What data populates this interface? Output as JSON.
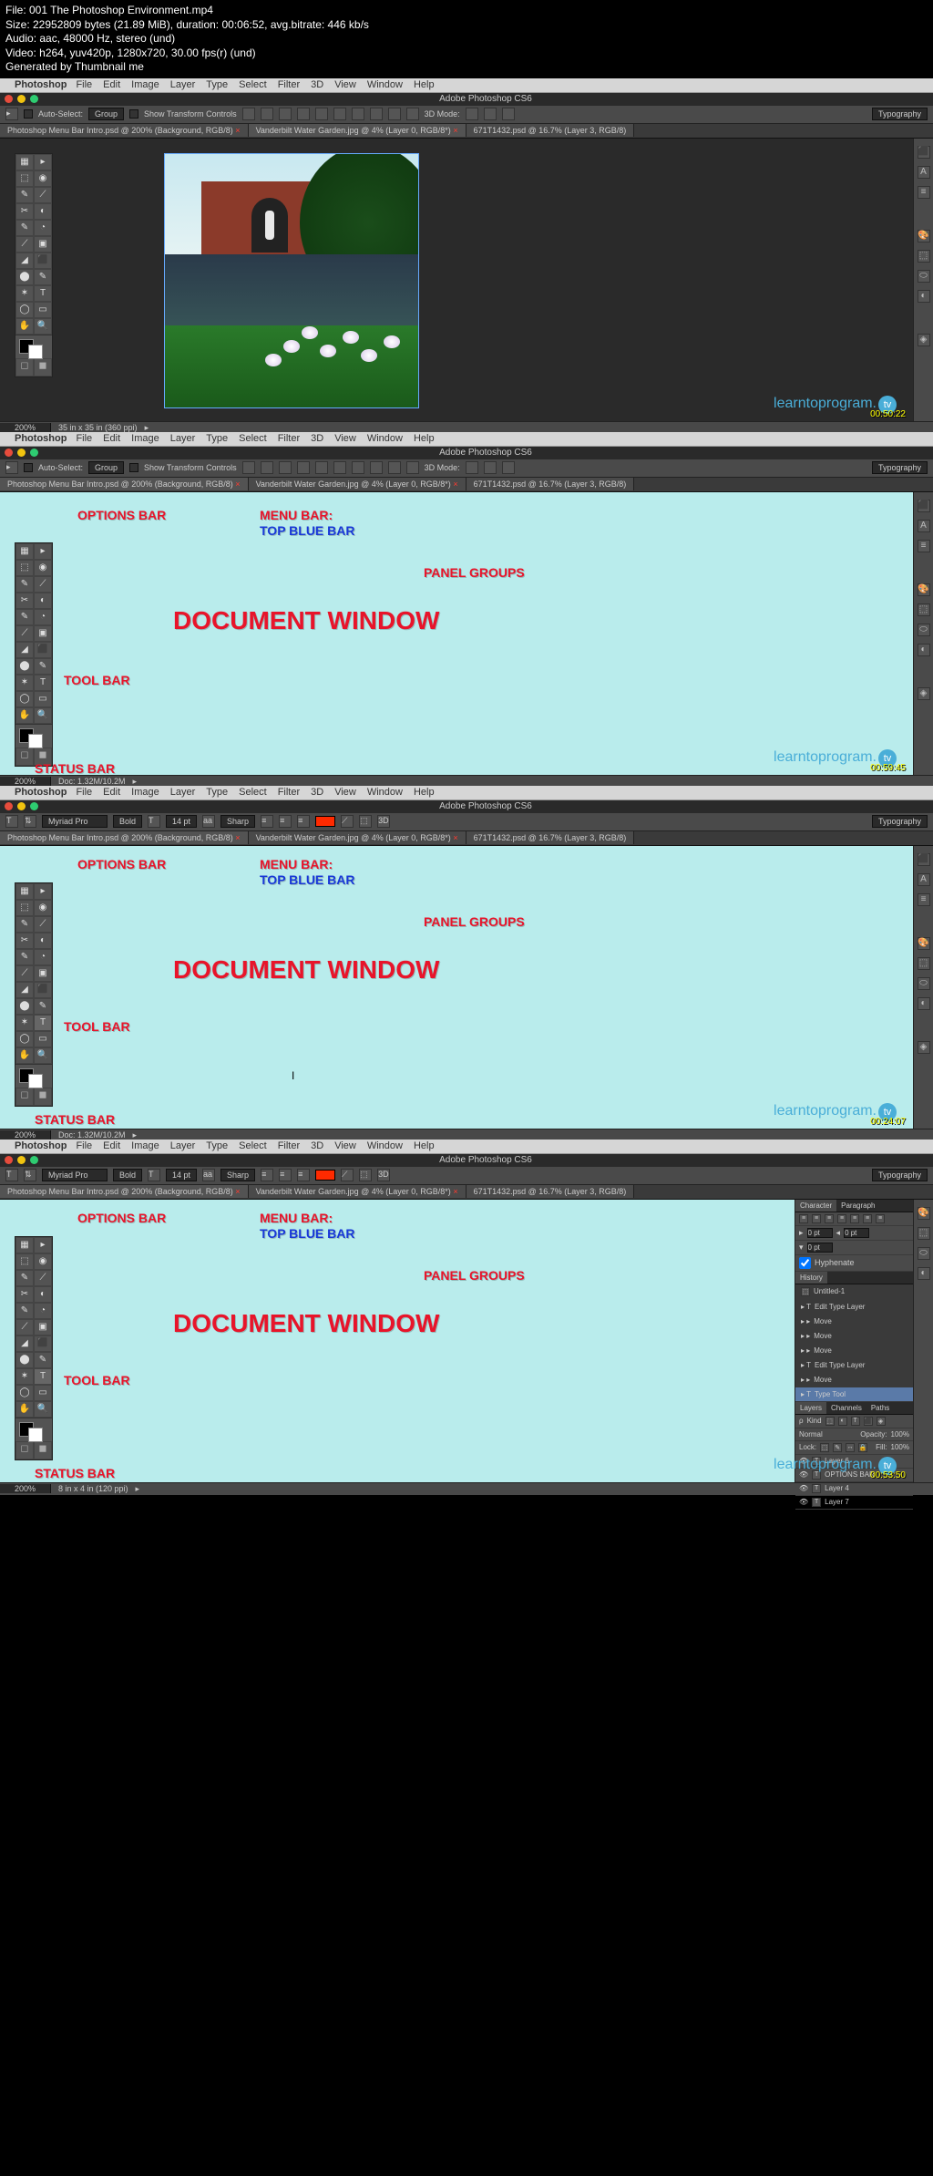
{
  "meta": {
    "file": "File: 001 The Photoshop Environment.mp4",
    "size": "Size: 22952809 bytes (21.89 MiB), duration: 00:06:52, avg.bitrate: 446 kb/s",
    "audio": "Audio: aac, 48000 Hz, stereo (und)",
    "video": "Video: h264, yuv420p, 1280x720, 30.00 fps(r) (und)",
    "gen": "Generated by Thumbnail me"
  },
  "mac": {
    "app": "Photoshop",
    "items": [
      "File",
      "Edit",
      "Image",
      "Layer",
      "Type",
      "Select",
      "Filter",
      "3D",
      "View",
      "Window",
      "Help"
    ]
  },
  "title": "Adobe Photoshop CS6",
  "opt1": {
    "auto": "Auto-Select:",
    "group": "Group",
    "stc": "Show Transform Controls",
    "mode": "3D Mode:",
    "typo": "Typography"
  },
  "opt2": {
    "font": "Myriad Pro",
    "weight": "Bold",
    "size": "14 pt",
    "aa": "Sharp",
    "typo": "Typography"
  },
  "tabs": {
    "t1": "Photoshop Menu Bar Intro.psd @ 200% (Background, RGB/8)",
    "t2": "Vanderbilt Water Garden.jpg @ 4% (Layer 0, RGB/8*)",
    "t3": "671T1432.psd @ 16.7% (Layer 3, RGB/8)"
  },
  "ov": {
    "options": "OPTIONS BAR",
    "menu1": "MENU BAR:",
    "menu2": "TOP BLUE BAR",
    "panel": "PANEL GROUPS",
    "doc": "DOCUMENT WINDOW",
    "tool": "TOOL BAR",
    "status": "STATUS BAR"
  },
  "brand": "learntoprogram.",
  "tv": "tv",
  "ts": [
    "00:50:22",
    "00:59:45",
    "00:24:07",
    "00:53:50"
  ],
  "st": {
    "zoom": "200%",
    "d1": "35 in x 35 in (360 ppi)",
    "d2": "Doc: 1.32M/10.2M",
    "d3": "8 in x 4 in (120 ppi)"
  },
  "char": {
    "t": "Character",
    "p": "Paragraph",
    "pt0": "0 pt",
    "hyph": "Hyphenate"
  },
  "hist": {
    "t": "History",
    "items": [
      "Untitled-1",
      "Edit Type Layer",
      "Move",
      "Move",
      "Move",
      "Edit Type Layer",
      "Move",
      "Type Tool"
    ]
  },
  "lay": {
    "t": "Layers",
    "ch": "Channels",
    "pa": "Paths",
    "kind": "Kind",
    "norm": "Normal",
    "op": "Opacity:",
    "opv": "100%",
    "lock": "Lock:",
    "fill": "Fill:",
    "fillv": "100%",
    "items": [
      "Layer 6",
      "OPTIONS BAR",
      "Layer 4",
      "Layer 7"
    ]
  }
}
